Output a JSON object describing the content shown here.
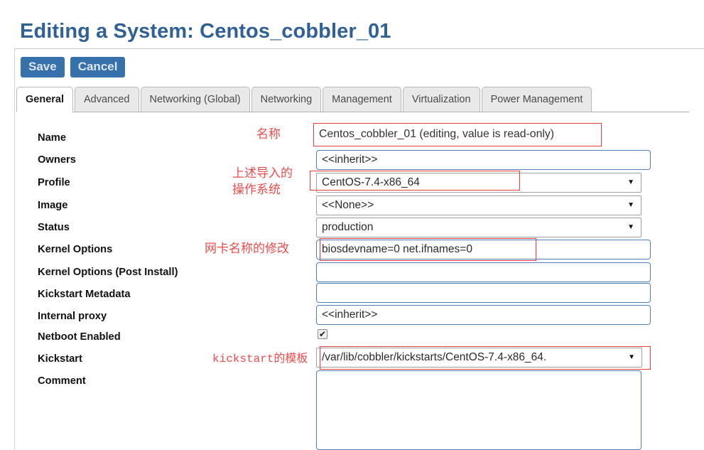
{
  "page": {
    "title": "Editing a System: Centos_cobbler_01"
  },
  "toolbar": {
    "save_label": "Save",
    "cancel_label": "Cancel"
  },
  "tabs": [
    {
      "label": "General",
      "active": true
    },
    {
      "label": "Advanced",
      "active": false
    },
    {
      "label": "Networking (Global)",
      "active": false
    },
    {
      "label": "Networking",
      "active": false
    },
    {
      "label": "Management",
      "active": false
    },
    {
      "label": "Virtualization",
      "active": false
    },
    {
      "label": "Power Management",
      "active": false
    }
  ],
  "form": {
    "labels": {
      "name": "Name",
      "owners": "Owners",
      "profile": "Profile",
      "image": "Image",
      "status": "Status",
      "kernel_options": "Kernel Options",
      "kernel_options_post": "Kernel Options (Post Install)",
      "kickstart_metadata": "Kickstart Metadata",
      "internal_proxy": "Internal proxy",
      "netboot_enabled": "Netboot Enabled",
      "kickstart": "Kickstart",
      "comment": "Comment"
    },
    "values": {
      "name": "Centos_cobbler_01 (editing, value is read-only)",
      "owners": "<<inherit>>",
      "profile": "CentOS-7.4-x86_64",
      "image": "<<None>>",
      "status": "production",
      "kernel_options": "biosdevname=0 net.ifnames=0",
      "kernel_options_post": "",
      "kickstart_metadata": "",
      "internal_proxy": "<<inherit>>",
      "netboot_enabled": true,
      "netboot_check_glyph": "✔",
      "kickstart": "/var/lib/cobbler/kickstarts/CentOS-7.4-x86_64.",
      "comment": ""
    },
    "select_caret_glyph": "▼"
  },
  "annotations": {
    "name_note": "名称",
    "profile_note_line1": "上述导入的",
    "profile_note_line2": "操作系统",
    "kernel_note": "网卡名称的修改",
    "kickstart_note": "kickstart的模板"
  },
  "colors": {
    "title_blue": "#2f6096",
    "button_blue": "#3771ab",
    "annotation_red": "#ef4b4b",
    "input_border_blue": "#4f7fb5"
  }
}
